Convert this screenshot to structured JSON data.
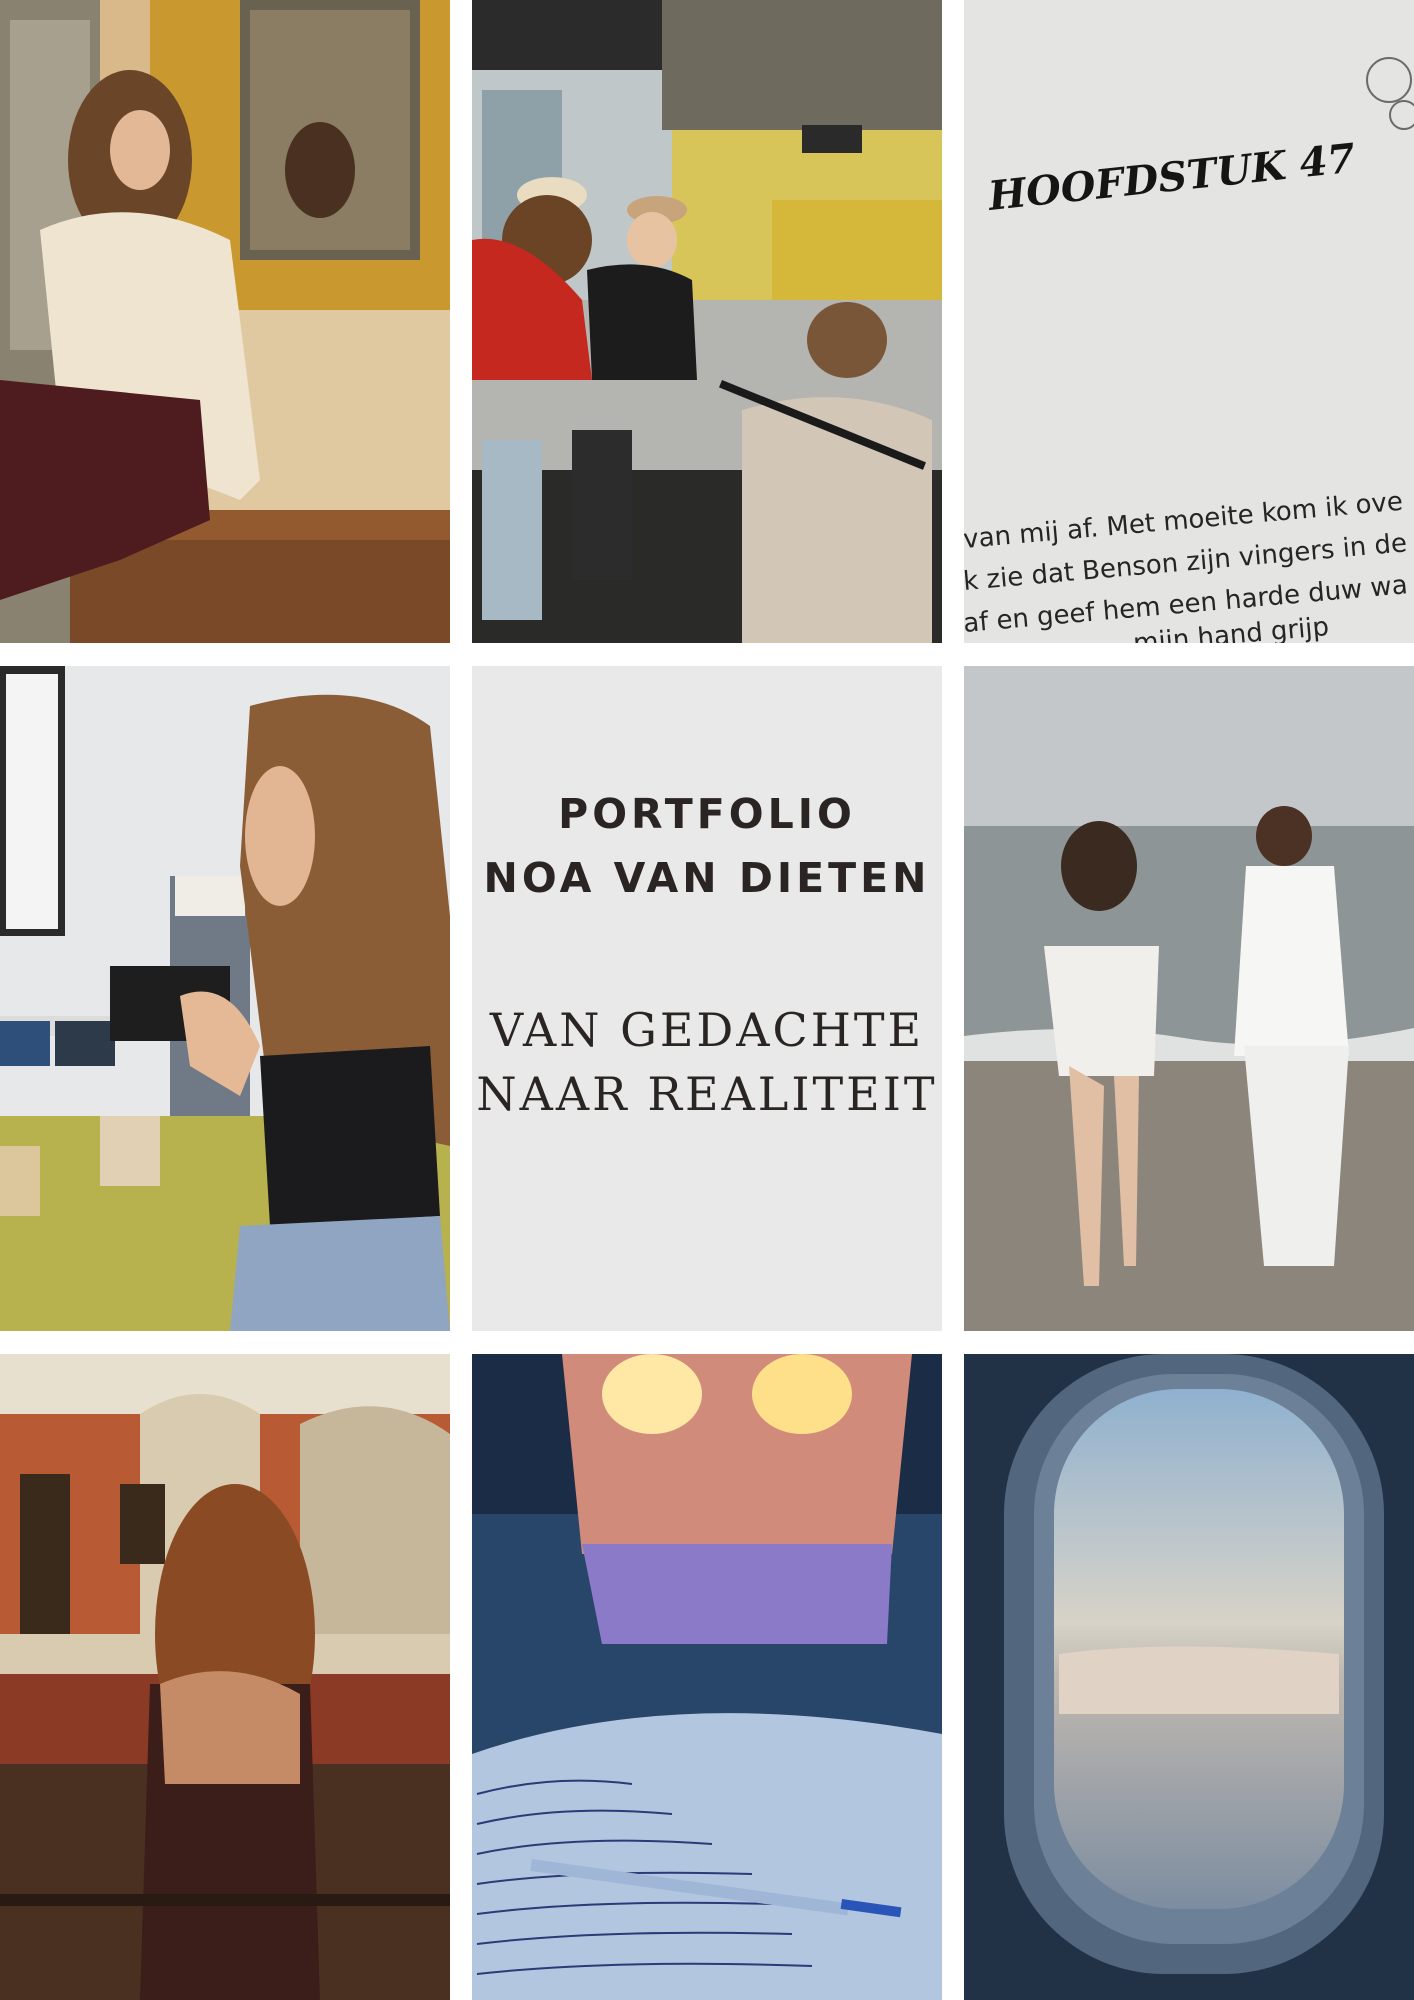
{
  "title": {
    "line1": "PORTFOLIO",
    "line2": "NOA VAN DIETEN"
  },
  "subtitle": {
    "line1": "VAN GEDACHTE",
    "line2": "NAAR REALITEIT"
  },
  "book_page": {
    "heading": "HOOFDSTUK 47",
    "lines": [
      "van mij af. Met moeite kom ik ove",
      "k zie dat Benson zijn vingers in de",
      "af en geef hem een harde duw wa",
      "mijn hand grijp"
    ]
  },
  "colors": {
    "title_background": "#e8e9e8",
    "title_text": "#2a2522",
    "gutter": "#ffffff"
  }
}
